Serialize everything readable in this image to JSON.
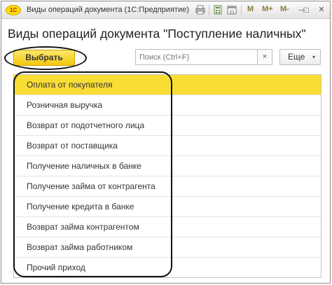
{
  "window": {
    "title": "Виды операций документа (1С:Предприятие)",
    "app_icon_text": "1С",
    "toolbar": {
      "m_label": "M",
      "m_plus_label": "M+",
      "m_minus_label": "M-",
      "minimize_glyph": "—",
      "maximize_glyph": "□",
      "close_glyph": "✕"
    }
  },
  "form": {
    "title": "Виды операций документа \"Поступление наличных\""
  },
  "command_bar": {
    "select_label": "Выбрать",
    "search_placeholder": "Поиск (Ctrl+F)",
    "clear_glyph": "×",
    "more_label": "Еще",
    "more_caret": "▾"
  },
  "list": {
    "selected_index": 0,
    "items": [
      "Оплата от покупателя",
      "Розничная выручка",
      "Возврат от подотчетного лица",
      "Возврат от поставщика",
      "Получение наличных в банке",
      "Получение займа от контрагента",
      "Получение кредита в банке",
      "Возврат займа контрагентом",
      "Возврат займа работником",
      "Прочий приход"
    ]
  },
  "colors": {
    "accent_yellow": "#f9dd35",
    "button_yellow": "#f2c80f"
  }
}
